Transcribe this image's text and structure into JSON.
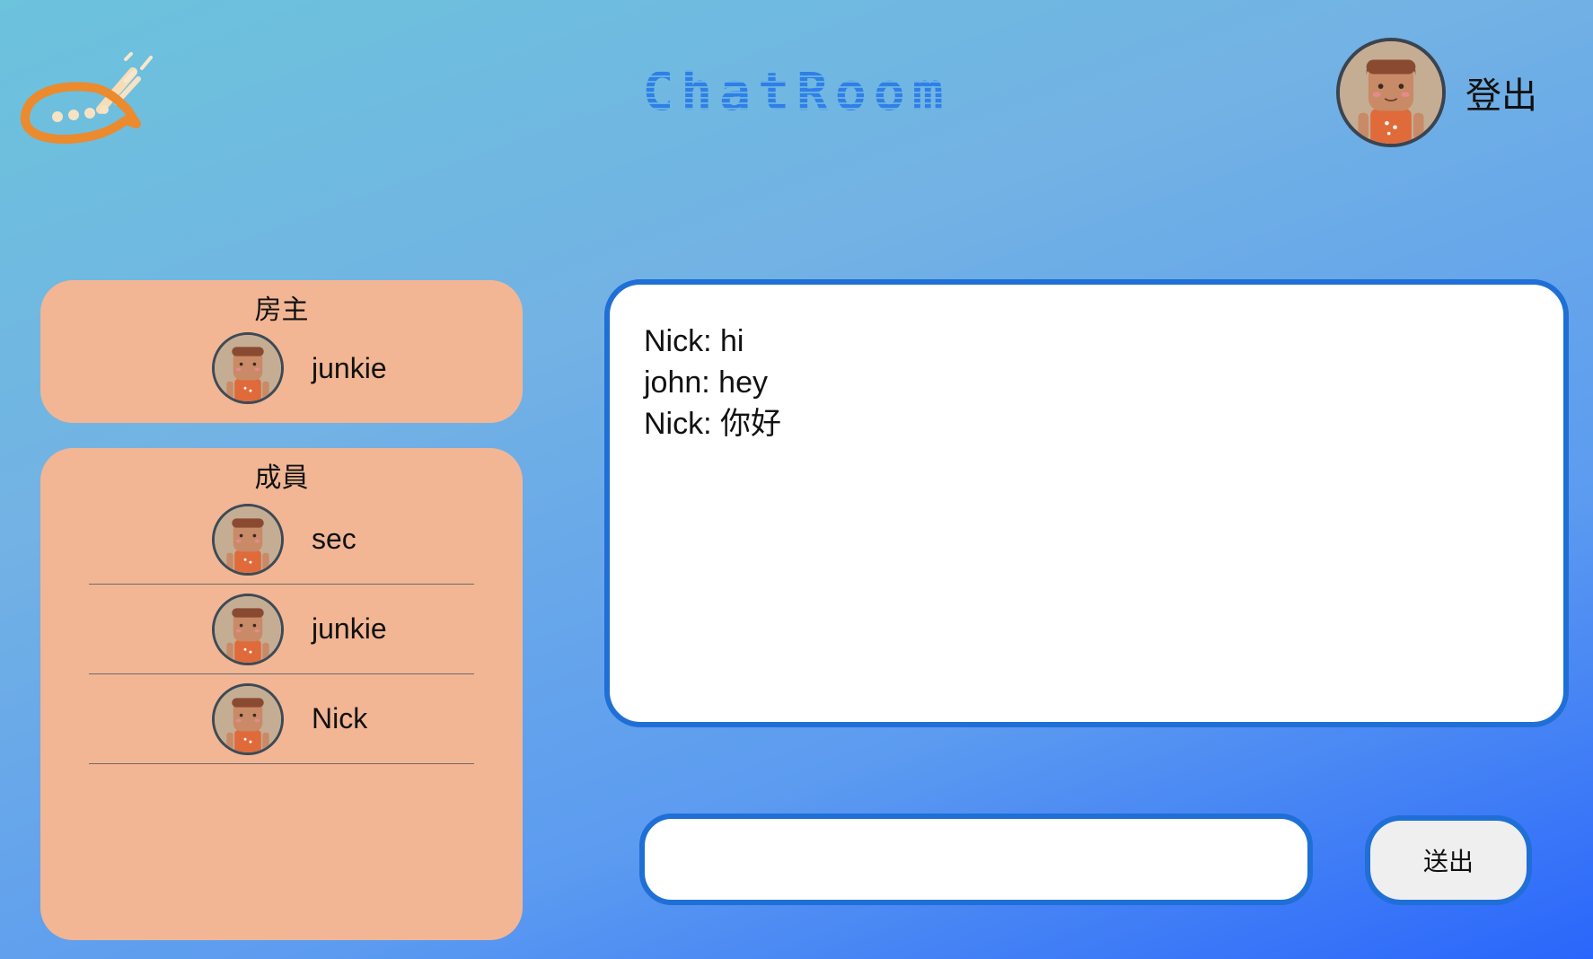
{
  "header": {
    "logo_icon": "chat-bubble-logo-icon",
    "title": "ChatRoom",
    "logout_label": "登出"
  },
  "owner_panel": {
    "title": "房主",
    "owner": {
      "name": "junkie",
      "avatar": "boy-avatar-icon"
    }
  },
  "members_panel": {
    "title": "成員",
    "members": [
      {
        "name": "sec",
        "avatar": "boy-avatar-icon"
      },
      {
        "name": "junkie",
        "avatar": "boy-avatar-icon"
      },
      {
        "name": "Nick",
        "avatar": "boy-avatar-icon"
      }
    ]
  },
  "chat": {
    "messages": [
      "Nick: hi",
      "john: hey",
      "Nick: 你好"
    ]
  },
  "composer": {
    "input_value": "",
    "send_label": "送出"
  },
  "colors": {
    "accent_blue": "#1f6fd6",
    "panel_peach": "#f2b694",
    "logo_orange": "#ec8a2e"
  }
}
